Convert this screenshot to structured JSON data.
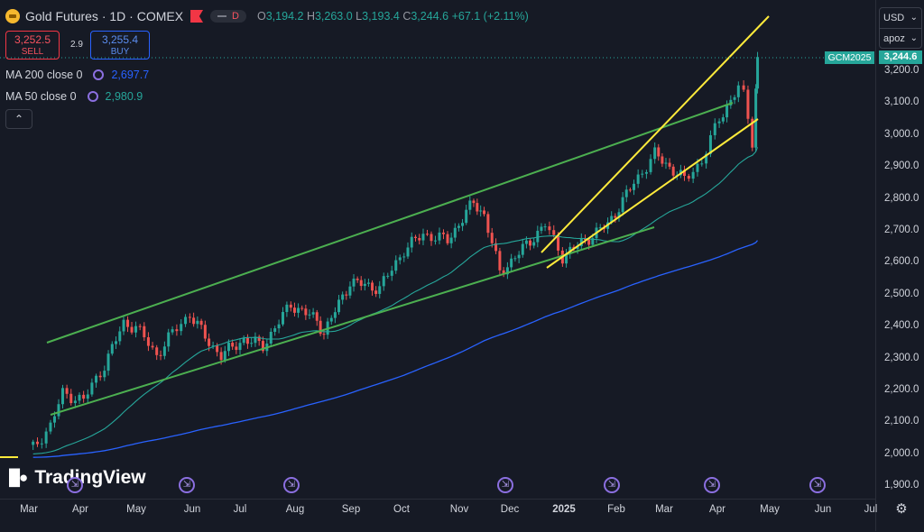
{
  "header": {
    "symbol_title": "Gold Futures · 1D · COMEX",
    "mode_label": "D",
    "ohlc": {
      "o_label": "O",
      "o": "3,194.2",
      "h_label": "H",
      "h": "3,263.0",
      "l_label": "L",
      "l": "3,193.4",
      "c_label": "C",
      "c": "3,244.6",
      "change": "+67.1 (+2.11%)"
    }
  },
  "trade": {
    "sell_price": "3,252.5",
    "sell_label": "SELL",
    "spread": "2.9",
    "buy_price": "3,255.4",
    "buy_label": "BUY"
  },
  "indicators": [
    {
      "label": "MA 200 close 0",
      "value": "2,697.7",
      "color": "#2962ff"
    },
    {
      "label": "MA 50 close 0",
      "value": "2,980.9",
      "color": "#26a69a"
    }
  ],
  "collapse_icon": "chevron-up-icon",
  "currency": {
    "selected": "USD",
    "unit": "apoz"
  },
  "price_tag": "3,244.6",
  "symbol_tag": "GCM2025",
  "y_axis": [
    "3,200.0",
    "3,100.0",
    "3,000.0",
    "2,900.0",
    "2,800.0",
    "2,700.0",
    "2,600.0",
    "2,500.0",
    "2,400.0",
    "2,300.0",
    "2,200.0",
    "2,100.0",
    "2,000.0",
    "1,900.0"
  ],
  "x_axis": [
    {
      "label": "Mar",
      "bold": false
    },
    {
      "label": "Apr",
      "bold": false
    },
    {
      "label": "May",
      "bold": false
    },
    {
      "label": "Jun",
      "bold": false
    },
    {
      "label": "Jul",
      "bold": false
    },
    {
      "label": "Aug",
      "bold": false
    },
    {
      "label": "Sep",
      "bold": false
    },
    {
      "label": "Oct",
      "bold": false
    },
    {
      "label": "Nov",
      "bold": false
    },
    {
      "label": "Dec",
      "bold": false
    },
    {
      "label": "2025",
      "bold": true
    },
    {
      "label": "Feb",
      "bold": false
    },
    {
      "label": "Mar",
      "bold": false
    },
    {
      "label": "Apr",
      "bold": false
    },
    {
      "label": "May",
      "bold": false
    },
    {
      "label": "Jun",
      "bold": false
    },
    {
      "label": "Jul",
      "bold": false
    }
  ],
  "branding": "TradingView",
  "settings_icon": "gear-icon",
  "colors": {
    "up": "#26a69a",
    "down": "#ef5350",
    "channel": "#4caf50",
    "wedge": "#ffeb3b",
    "ma200": "#2962ff",
    "ma50": "#26a69a",
    "event": "#8b6fe0"
  },
  "chart_data": {
    "type": "candlestick",
    "ylim": [
      1880,
      3320
    ],
    "x_ticks": [
      "Mar",
      "Apr",
      "May",
      "Jun",
      "Jul",
      "Aug",
      "Sep",
      "Oct",
      "Nov",
      "Dec",
      "2025",
      "Feb",
      "Mar",
      "Apr",
      "May",
      "Jun",
      "Jul"
    ],
    "close_series": [
      {
        "date": "2024-02-20",
        "close": 2020
      },
      {
        "date": "2024-03-01",
        "close": 2090
      },
      {
        "date": "2024-03-08",
        "close": 2190
      },
      {
        "date": "2024-03-20",
        "close": 2170
      },
      {
        "date": "2024-04-01",
        "close": 2280
      },
      {
        "date": "2024-04-12",
        "close": 2410
      },
      {
        "date": "2024-04-19",
        "close": 2400
      },
      {
        "date": "2024-05-01",
        "close": 2310
      },
      {
        "date": "2024-05-10",
        "close": 2380
      },
      {
        "date": "2024-05-20",
        "close": 2440
      },
      {
        "date": "2024-05-31",
        "close": 2350
      },
      {
        "date": "2024-06-07",
        "close": 2310
      },
      {
        "date": "2024-06-20",
        "close": 2360
      },
      {
        "date": "2024-07-01",
        "close": 2340
      },
      {
        "date": "2024-07-17",
        "close": 2470
      },
      {
        "date": "2024-08-01",
        "close": 2420
      },
      {
        "date": "2024-08-05",
        "close": 2380
      },
      {
        "date": "2024-08-20",
        "close": 2540
      },
      {
        "date": "2024-09-06",
        "close": 2520
      },
      {
        "date": "2024-09-20",
        "close": 2640
      },
      {
        "date": "2024-10-01",
        "close": 2690
      },
      {
        "date": "2024-10-15",
        "close": 2670
      },
      {
        "date": "2024-10-30",
        "close": 2790
      },
      {
        "date": "2024-11-05",
        "close": 2750
      },
      {
        "date": "2024-11-14",
        "close": 2570
      },
      {
        "date": "2024-11-25",
        "close": 2630
      },
      {
        "date": "2024-12-10",
        "close": 2720
      },
      {
        "date": "2024-12-20",
        "close": 2620
      },
      {
        "date": "2025-01-02",
        "close": 2670
      },
      {
        "date": "2025-01-15",
        "close": 2720
      },
      {
        "date": "2025-01-30",
        "close": 2850
      },
      {
        "date": "2025-02-11",
        "close": 2940
      },
      {
        "date": "2025-02-28",
        "close": 2860
      },
      {
        "date": "2025-03-10",
        "close": 2920
      },
      {
        "date": "2025-03-20",
        "close": 3050
      },
      {
        "date": "2025-03-31",
        "close": 3150
      },
      {
        "date": "2025-04-03",
        "close": 3120
      },
      {
        "date": "2025-04-08",
        "close": 2980
      },
      {
        "date": "2025-04-10",
        "close": 3150
      },
      {
        "date": "2025-04-11",
        "close": 3244.6
      }
    ],
    "series": [
      {
        "name": "MA 200 close 0",
        "last": 2697.7
      },
      {
        "name": "MA 50 close 0",
        "last": 2980.9
      }
    ],
    "last_price": 3244.6
  }
}
